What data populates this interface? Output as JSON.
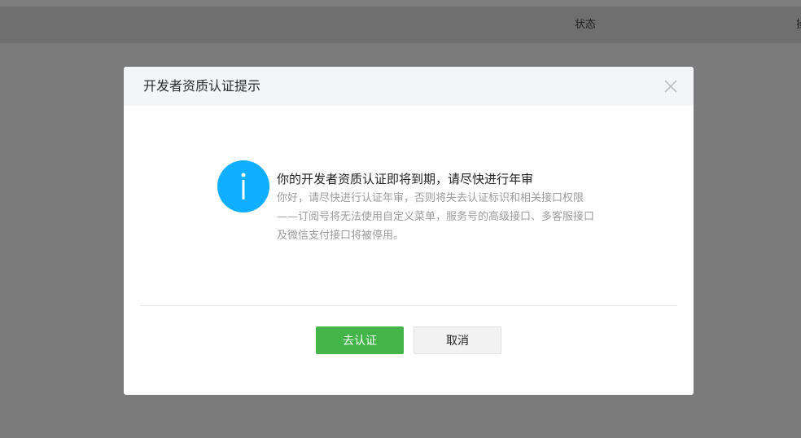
{
  "background": {
    "table_header": {
      "status_label": "状态",
      "cut_label": "操"
    }
  },
  "dialog": {
    "title": "开发者资质认证提示",
    "close_icon": "close-icon",
    "info_icon": "info-icon",
    "message_title": "你的开发者资质认证即将到期，请尽快进行年审",
    "message_desc": "你好，请尽快进行认证年审，否则将失去认证标识和相关接口权限——订阅号将无法使用自定义菜单，服务号的高级接口、多客服接口及微信支付接口将被停用。",
    "confirm_label": "去认证",
    "cancel_label": "取消"
  },
  "colors": {
    "overlay": "#7b7b7b",
    "dialog_header_bg": "#f3f5f8",
    "info_icon": "#10aeff",
    "primary_button": "#44b549",
    "default_button": "#f2f2f2",
    "desc_text": "#9a9a9a"
  }
}
